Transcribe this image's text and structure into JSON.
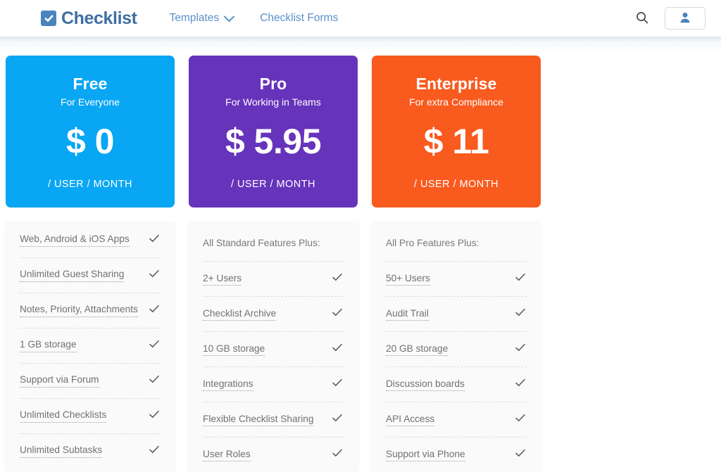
{
  "header": {
    "brand_name": "Checklist",
    "brand_icon": "checkbox-check-icon",
    "nav": [
      {
        "label": "Templates",
        "has_dropdown": true
      },
      {
        "label": "Checklist Forms",
        "has_dropdown": false
      }
    ],
    "search_icon": "search-icon",
    "account_icon": "user-person-icon",
    "link_color": "#5b90cb",
    "brand_color": "#3f6fa3"
  },
  "plans": [
    {
      "name": "Free",
      "tagline": "For Everyone",
      "price": "$ 0",
      "period": "/ USER / MONTH",
      "color": "#09a6f3",
      "note": "",
      "features": [
        {
          "label": "Web, Android & iOS Apps",
          "included": true
        },
        {
          "label": "Unlimited Guest Sharing",
          "included": true
        },
        {
          "label": "Notes, Priority, Attachments",
          "included": true
        },
        {
          "label": "1 GB storage",
          "included": true
        },
        {
          "label": "Support via Forum",
          "included": true
        },
        {
          "label": "Unlimited Checklists",
          "included": true
        },
        {
          "label": "Unlimited Subtasks",
          "included": true
        }
      ]
    },
    {
      "name": "Pro",
      "tagline": "For Working in Teams",
      "price": "$ 5.95",
      "period": "/ USER / MONTH",
      "color": "#6633bb",
      "note": "All Standard Features Plus:",
      "features": [
        {
          "label": "2+ Users",
          "included": true
        },
        {
          "label": "Checklist Archive",
          "included": true
        },
        {
          "label": "10 GB storage",
          "included": true
        },
        {
          "label": "Integrations",
          "included": true
        },
        {
          "label": "Flexible Checklist Sharing",
          "included": true
        },
        {
          "label": "User Roles",
          "included": true
        }
      ]
    },
    {
      "name": "Enterprise",
      "tagline": "For extra Compliance",
      "price": "$ 11",
      "period": "/ USER / MONTH",
      "color": "#f95a1e",
      "note": "All Pro Features Plus:",
      "features": [
        {
          "label": "50+ Users",
          "included": true
        },
        {
          "label": "Audit Trail",
          "included": true
        },
        {
          "label": "20 GB storage",
          "included": true
        },
        {
          "label": "Discussion boards",
          "included": true
        },
        {
          "label": "API Access",
          "included": true
        },
        {
          "label": "Support via Phone",
          "included": true
        }
      ]
    }
  ]
}
